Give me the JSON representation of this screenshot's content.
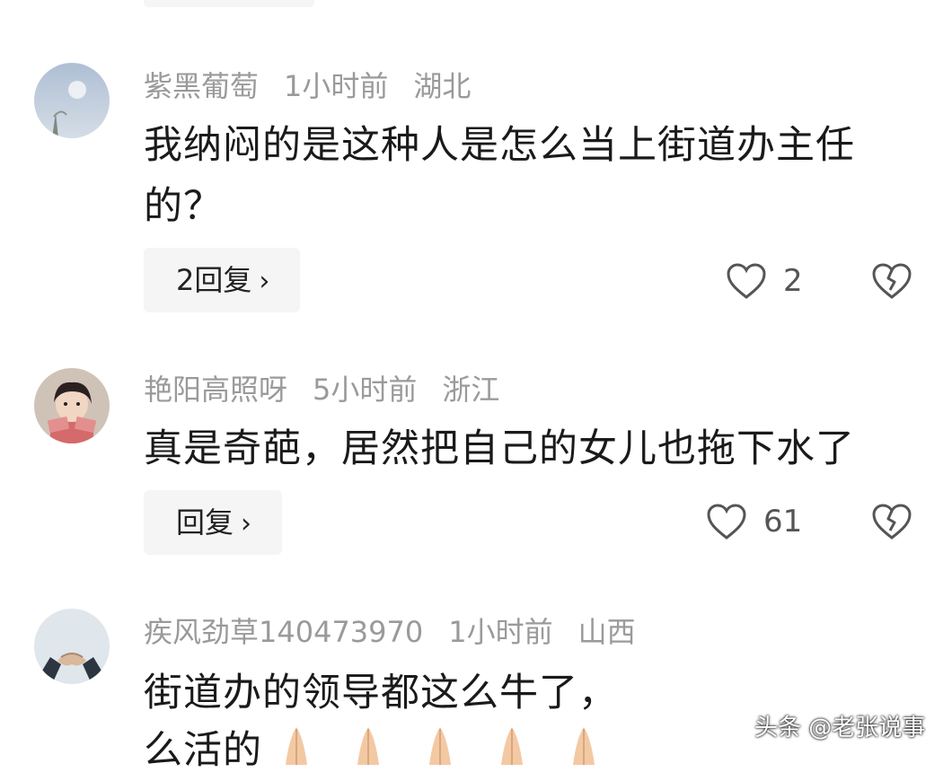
{
  "comments": [
    {
      "username": "紫黑葡萄",
      "time": "1小时前",
      "location": "湖北",
      "text": "我纳闷的是这种人是怎么当上街道办主任的？",
      "reply_label": "2回复",
      "likes": "2"
    },
    {
      "username": "艳阳高照呀",
      "time": "5小时前",
      "location": "浙江",
      "text": "真是奇葩，居然把自己的女儿也拖下水了",
      "reply_label": "回复",
      "likes": "61"
    },
    {
      "username": "疾风劲草140473970",
      "time": "1小时前",
      "location": "山西",
      "text_line1": "街道办的领导都这么牛了，",
      "text_line2": "么活的"
    }
  ],
  "watermark": "头条 @老张说事",
  "icons": {
    "like": "heart-outline-icon",
    "dislike": "broken-heart-icon",
    "chevron": "chevron-right-icon",
    "emoji": "praying-hands-emoji"
  },
  "colors": {
    "meta_text": "#9a9a9a",
    "reply_bg": "#f5f5f5",
    "body_text": "#1a1a1a"
  }
}
